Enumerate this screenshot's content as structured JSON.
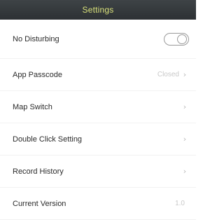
{
  "header": {
    "title": "Settings"
  },
  "rows": [
    {
      "label": "No Disturbing",
      "type": "toggle",
      "toggle_on": false
    },
    {
      "label": "App Passcode",
      "value": "Closed",
      "type": "link"
    },
    {
      "label": "Map Switch",
      "type": "link"
    },
    {
      "label": "Double Click Setting",
      "type": "link"
    },
    {
      "label": "Record History",
      "type": "link"
    },
    {
      "label": "Current Version",
      "value": "1.0",
      "type": "info"
    }
  ],
  "icons": {
    "chevron": "chevron-right-icon"
  }
}
